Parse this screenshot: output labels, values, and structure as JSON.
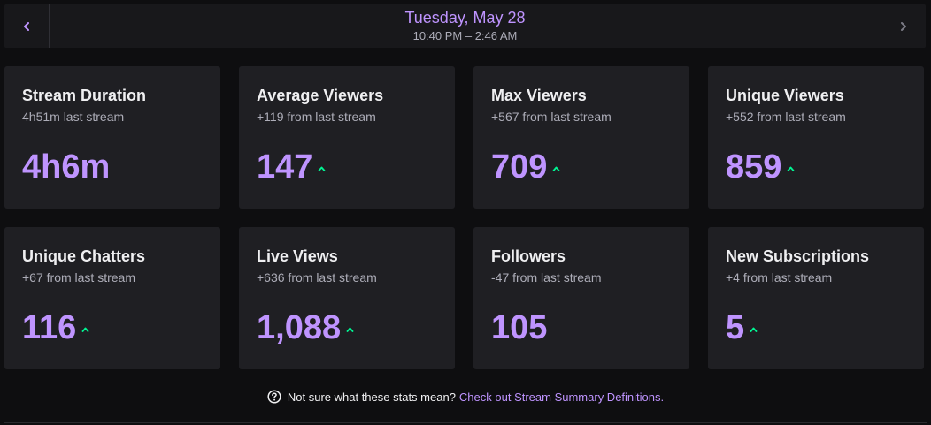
{
  "header": {
    "date": "Tuesday, May 28",
    "time_range": "10:40 PM – 2:46 AM",
    "prev_icon": "chevron-left-icon",
    "next_icon": "chevron-right-icon"
  },
  "colors": {
    "background": "#0e0e10",
    "card": "#1f1f23",
    "accent": "#bf94ff",
    "up_arrow": "#00f593",
    "muted_text": "#adadb8"
  },
  "cards": [
    {
      "title": "Stream Duration",
      "subtitle": "4h51m last stream",
      "value": "4h6m",
      "trend": "none"
    },
    {
      "title": "Average Viewers",
      "subtitle": "+119 from last stream",
      "value": "147",
      "trend": "up"
    },
    {
      "title": "Max Viewers",
      "subtitle": "+567 from last stream",
      "value": "709",
      "trend": "up"
    },
    {
      "title": "Unique Viewers",
      "subtitle": "+552 from last stream",
      "value": "859",
      "trend": "up"
    },
    {
      "title": "Unique Chatters",
      "subtitle": "+67 from last stream",
      "value": "116",
      "trend": "up"
    },
    {
      "title": "Live Views",
      "subtitle": "+636 from last stream",
      "value": "1,088",
      "trend": "up"
    },
    {
      "title": "Followers",
      "subtitle": "-47 from last stream",
      "value": "105",
      "trend": "none"
    },
    {
      "title": "New Subscriptions",
      "subtitle": "+4 from last stream",
      "value": "5",
      "trend": "up"
    }
  ],
  "footer": {
    "question": "Not sure what these stats mean?",
    "link_text": "Check out Stream Summary Definitions.",
    "icon": "help-circle-icon"
  }
}
